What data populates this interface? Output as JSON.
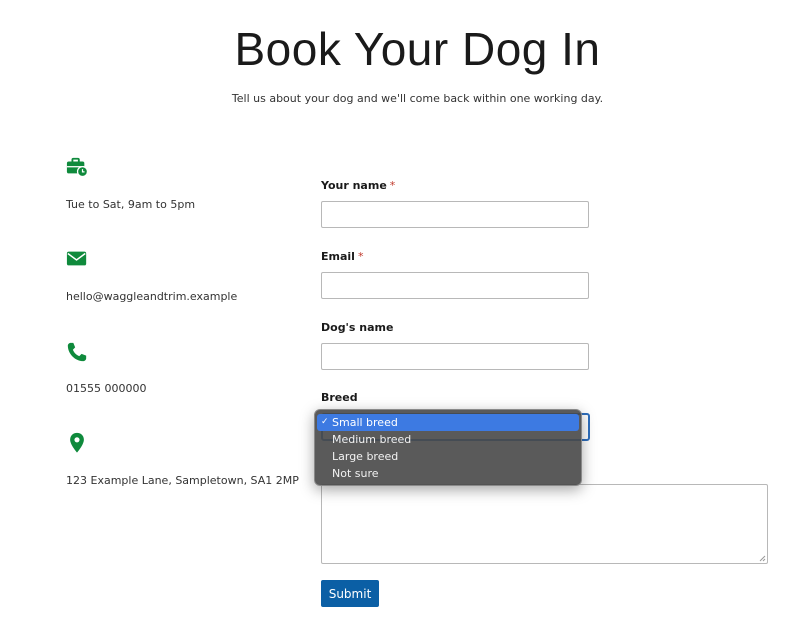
{
  "header": {
    "title": "Book Your Dog In",
    "subtitle": "Tell us about your dog and we'll come back within one working day."
  },
  "contact": {
    "hours": "Tue to Sat, 9am to 5pm",
    "email": "hello@waggleandtrim.example",
    "phone": "01555 000000",
    "address": "123 Example Lane, Sampletown, SA1 2MP"
  },
  "form": {
    "name_label": "Your name",
    "email_label": "Email",
    "required_marker": "*",
    "dog_name_label": "Dog's name",
    "breed_label": "Breed",
    "breed_selected": "Small breed",
    "breed_options": [
      "Small breed",
      "Medium breed",
      "Large breed",
      "Not sure"
    ],
    "checkmark": "✓",
    "submit_label": "Submit"
  },
  "icons": {
    "hours": "briefcase-clock-icon",
    "email": "envelope-icon",
    "phone": "phone-icon",
    "address": "map-pin-icon"
  },
  "colors": {
    "icon_green": "#0f8a3c",
    "button_blue": "#0b5fa5",
    "focus_blue": "#2f6fbd",
    "option_highlight": "#3d7ae2",
    "required_red": "#c0392b"
  }
}
